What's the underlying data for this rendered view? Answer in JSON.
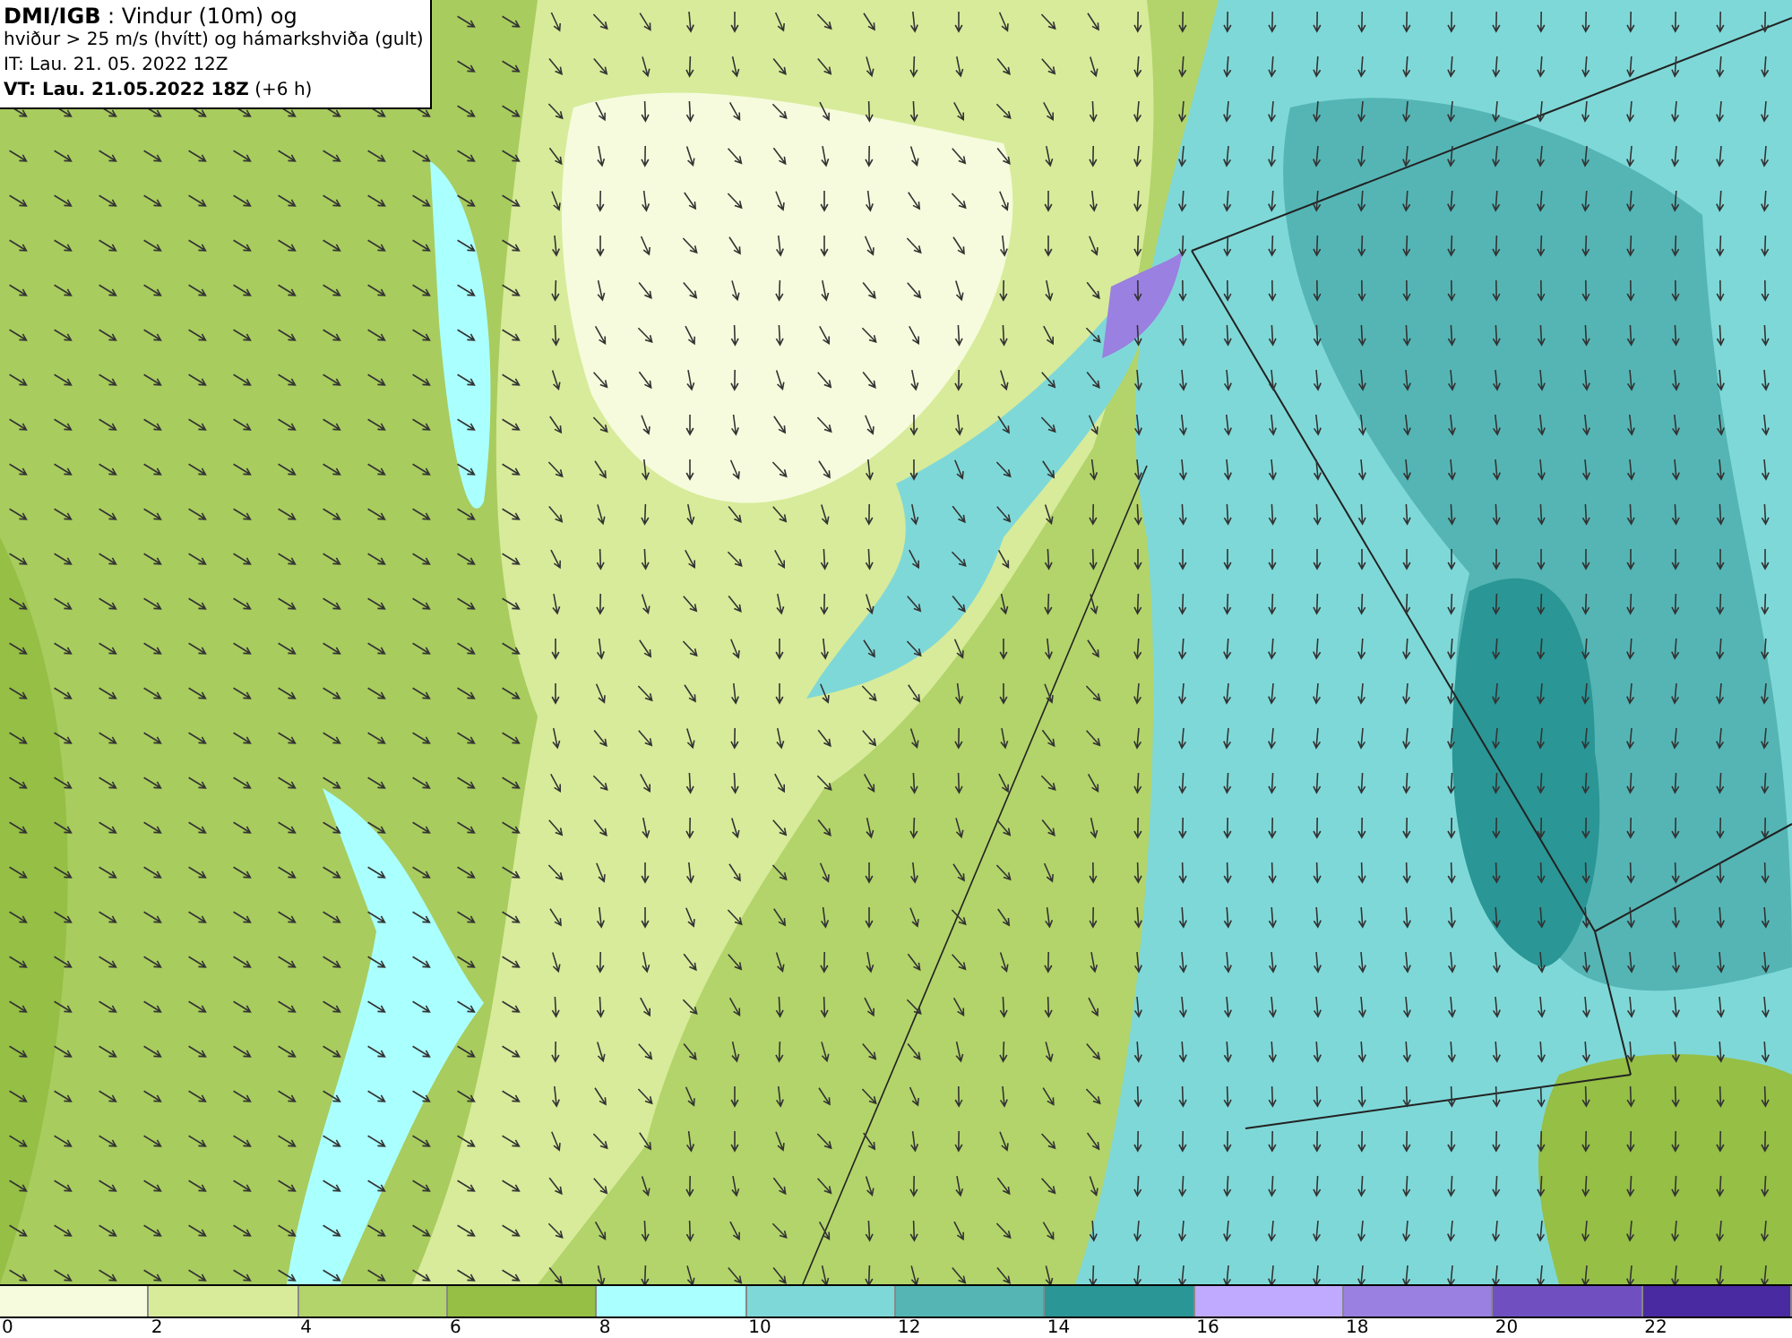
{
  "title_box": {
    "lines": [
      "**DMI/IGB** : Vindur (10m) og",
      "hviður > 25 m/s (hvítt) og hámarkshviða (gult)",
      "IT: Lau. 21. 05. 2022 12Z",
      "**VT: Lau. 21.05.2022 18Z** (+6 h)"
    ]
  },
  "legend": {
    "swatches": [
      {
        "color": "#f5fbdc"
      },
      {
        "color": "#d7eb9a"
      },
      {
        "color": "#b2d46a"
      },
      {
        "color": "#95bf45"
      },
      {
        "color": "#aaffff"
      },
      {
        "color": "#7fd8d8"
      },
      {
        "color": "#55b5b5"
      },
      {
        "color": "#2a9696"
      },
      {
        "color": "#c0aaff"
      },
      {
        "color": "#9a80e0"
      },
      {
        "color": "#7050c0"
      },
      {
        "color": "#4a2aa0"
      }
    ],
    "ticks": [
      "0",
      "2",
      "4",
      "6",
      "8",
      "10",
      "12",
      "14",
      "16",
      "18",
      "20",
      "22"
    ]
  }
}
